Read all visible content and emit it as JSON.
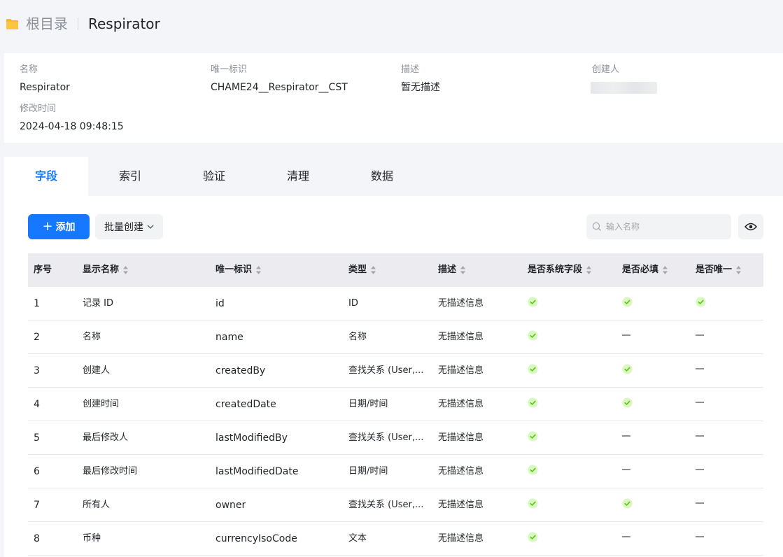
{
  "breadcrumb": {
    "root": "根目录",
    "current": "Respirator"
  },
  "info": {
    "name": {
      "label": "名称",
      "value": "Respirator"
    },
    "api_name": {
      "label": "唯一标识",
      "value": "CHAME24__Respirator__CST"
    },
    "description": {
      "label": "描述",
      "value": "暂无描述"
    },
    "creator": {
      "label": "创建人"
    },
    "modified": {
      "label": "修改时间",
      "value": "2024-04-18 09:48:15"
    }
  },
  "tabs": [
    {
      "label": "字段",
      "active": true
    },
    {
      "label": "索引"
    },
    {
      "label": "验证"
    },
    {
      "label": "清理"
    },
    {
      "label": "数据"
    }
  ],
  "toolbar": {
    "add_label": "添加",
    "batch_label": "批量创建",
    "search_placeholder": "输入名称"
  },
  "table": {
    "headers": [
      "序号",
      "显示名称",
      "唯一标识",
      "类型",
      "描述",
      "是否系统字段",
      "是否必填",
      "是否唯一"
    ],
    "rows": [
      {
        "index": "1",
        "display": "记录 ID",
        "api": "id",
        "type": "ID",
        "desc": "无描述信息",
        "system": true,
        "required": true,
        "unique": true
      },
      {
        "index": "2",
        "display": "名称",
        "api": "name",
        "type": "名称",
        "desc": "无描述信息",
        "system": true,
        "required": false,
        "unique": false
      },
      {
        "index": "3",
        "display": "创建人",
        "api": "createdBy",
        "type": "查找关系 (User,...",
        "desc": "无描述信息",
        "system": true,
        "required": true,
        "unique": false
      },
      {
        "index": "4",
        "display": "创建时间",
        "api": "createdDate",
        "type": "日期/时间",
        "desc": "无描述信息",
        "system": true,
        "required": true,
        "unique": false
      },
      {
        "index": "5",
        "display": "最后修改人",
        "api": "lastModifiedBy",
        "type": "查找关系 (User,...",
        "desc": "无描述信息",
        "system": true,
        "required": false,
        "unique": false
      },
      {
        "index": "6",
        "display": "最后修改时间",
        "api": "lastModifiedDate",
        "type": "日期/时间",
        "desc": "无描述信息",
        "system": true,
        "required": false,
        "unique": false
      },
      {
        "index": "7",
        "display": "所有人",
        "api": "owner",
        "type": "查找关系 (User,...",
        "desc": "无描述信息",
        "system": true,
        "required": true,
        "unique": false
      },
      {
        "index": "8",
        "display": "币种",
        "api": "currencyIsoCode",
        "type": "文本",
        "desc": "无描述信息",
        "system": true,
        "required": false,
        "unique": false
      }
    ]
  },
  "colors": {
    "accent": "#1677ff",
    "check": "#52c41a",
    "check_bg": "#d9f7be",
    "folder": "#f7b731"
  },
  "icons": {
    "folder": "folder-icon",
    "plus": "plus-icon",
    "chevron": "chevron-down-icon",
    "search": "search-icon",
    "eye": "eye-icon",
    "sort": "sort-icon",
    "check": "check-circle-icon",
    "dash": "dash-icon"
  }
}
